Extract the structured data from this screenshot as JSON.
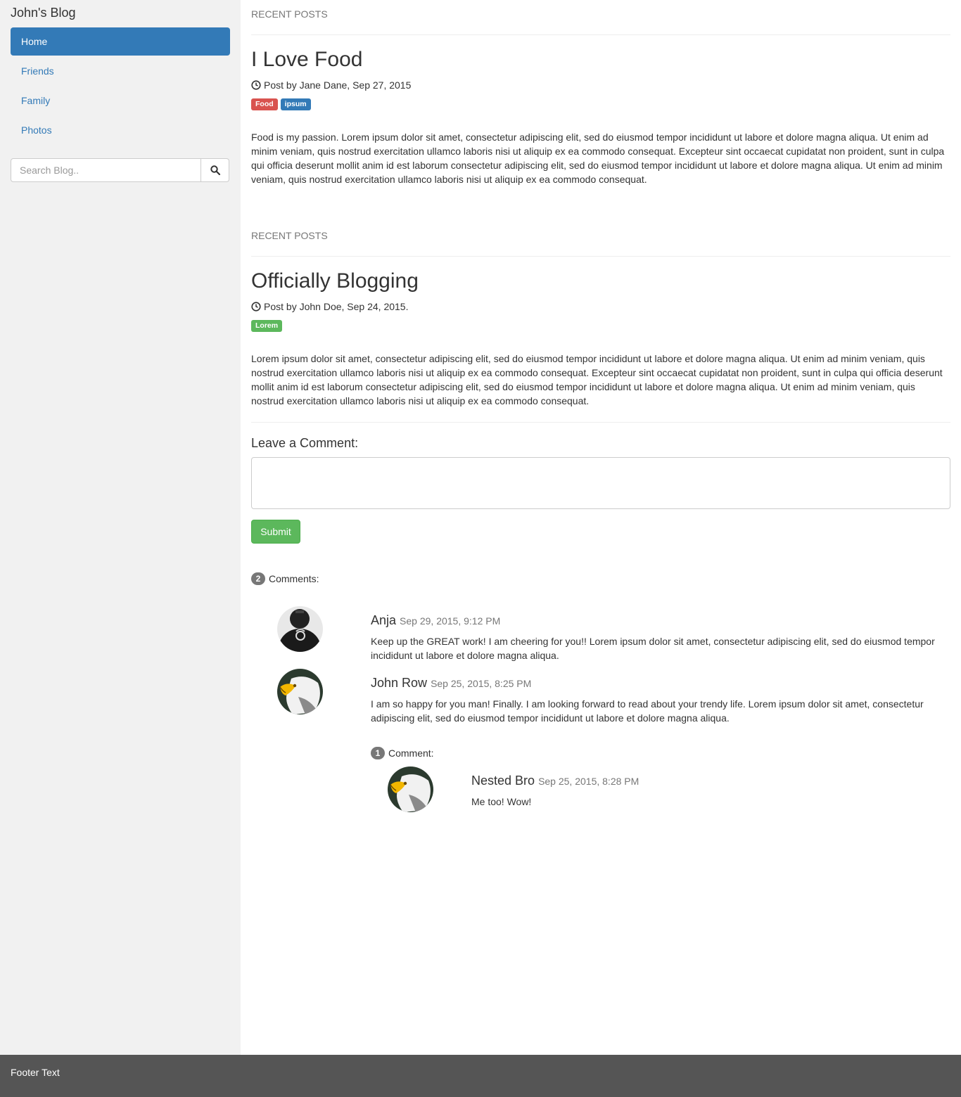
{
  "sidebar": {
    "brand": "John's Blog",
    "nav": [
      "Home",
      "Friends",
      "Family",
      "Photos"
    ],
    "search_placeholder": "Search Blog.."
  },
  "posts": [
    {
      "section": "RECENT POSTS",
      "title": "I Love Food",
      "meta": "Post by Jane Dane, Sep 27, 2015",
      "labels": [
        {
          "text": "Food",
          "color": "#d9534f"
        },
        {
          "text": "ipsum",
          "color": "#337ab7"
        }
      ],
      "body": "Food is my passion. Lorem ipsum dolor sit amet, consectetur adipiscing elit, sed do eiusmod tempor incididunt ut labore et dolore magna aliqua. Ut enim ad minim veniam, quis nostrud exercitation ullamco laboris nisi ut aliquip ex ea commodo consequat. Excepteur sint occaecat cupidatat non proident, sunt in culpa qui officia deserunt mollit anim id est laborum consectetur adipiscing elit, sed do eiusmod tempor incididunt ut labore et dolore magna aliqua. Ut enim ad minim veniam, quis nostrud exercitation ullamco laboris nisi ut aliquip ex ea commodo consequat."
    },
    {
      "section": "RECENT POSTS",
      "title": "Officially Blogging",
      "meta": "Post by John Doe, Sep 24, 2015.",
      "labels": [
        {
          "text": "Lorem",
          "color": "#5cb85c"
        }
      ],
      "body": "Lorem ipsum dolor sit amet, consectetur adipiscing elit, sed do eiusmod tempor incididunt ut labore et dolore magna aliqua. Ut enim ad minim veniam, quis nostrud exercitation ullamco laboris nisi ut aliquip ex ea commodo consequat. Excepteur sint occaecat cupidatat non proident, sunt in culpa qui officia deserunt mollit anim id est laborum consectetur adipiscing elit, sed do eiusmod tempor incididunt ut labore et dolore magna aliqua. Ut enim ad minim veniam, quis nostrud exercitation ullamco laboris nisi ut aliquip ex ea commodo consequat."
    }
  ],
  "comment_form": {
    "heading": "Leave a Comment:",
    "submit": "Submit"
  },
  "comments": {
    "count": "2",
    "count_label": "Comments:",
    "items": [
      {
        "name": "Anja",
        "date": "Sep 29, 2015, 9:12 PM",
        "text": "Keep up the GREAT work! I am cheering for you!! Lorem ipsum dolor sit amet, consectetur adipiscing elit, sed do eiusmod tempor incididunt ut labore et dolore magna aliqua."
      },
      {
        "name": "John Row",
        "date": "Sep 25, 2015, 8:25 PM",
        "text": "I am so happy for you man! Finally. I am looking forward to read about your trendy life. Lorem ipsum dolor sit amet, consectetur adipiscing elit, sed do eiusmod tempor incididunt ut labore et dolore magna aliqua.",
        "reply_count": "1",
        "reply_count_label": "Comment:",
        "reply": {
          "name": "Nested Bro",
          "date": "Sep 25, 2015, 8:28 PM",
          "text": "Me too! Wow!"
        }
      }
    ]
  },
  "footer": {
    "text": "Footer Text"
  }
}
